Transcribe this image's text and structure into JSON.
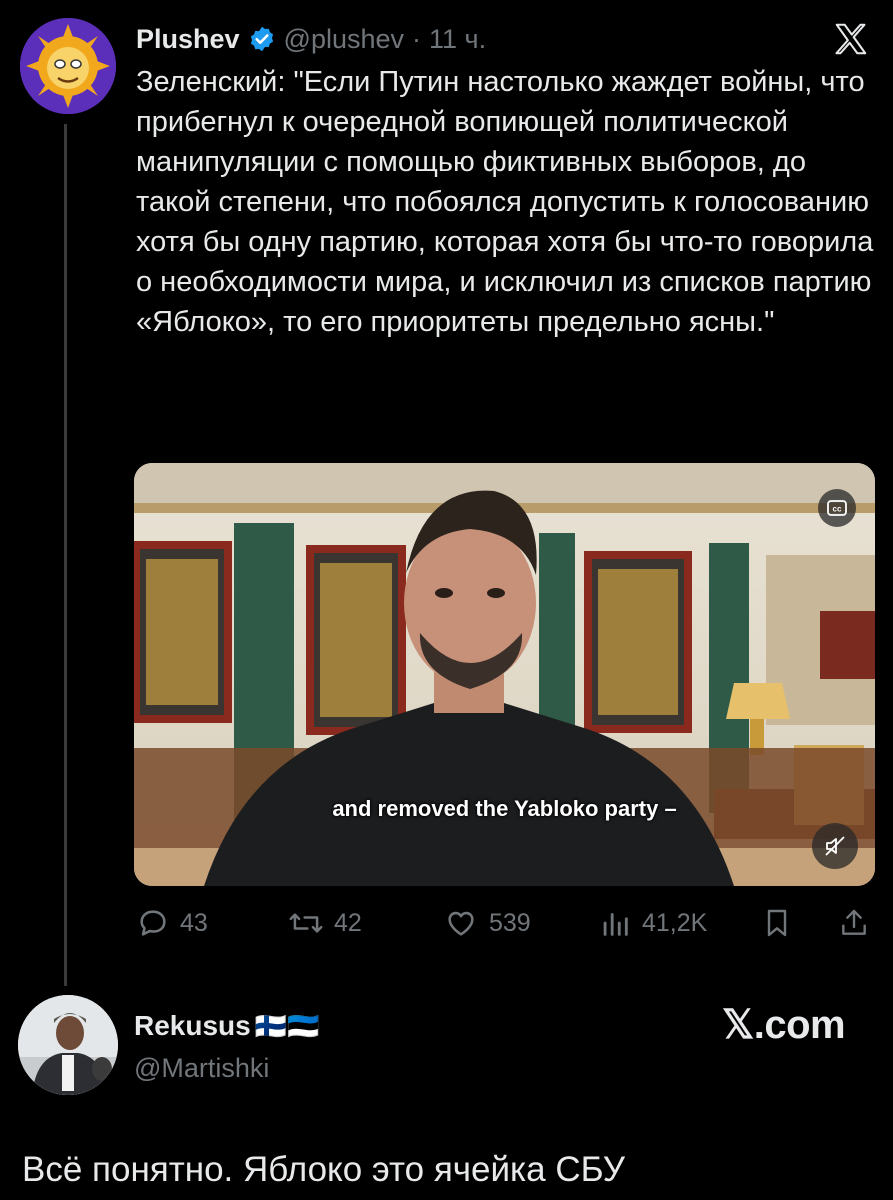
{
  "tweet": {
    "author_name": "Plushev",
    "handle": "@plushev",
    "separator": "·",
    "time": "11 ч.",
    "text": "Зеленский: \"Если Путин настолько жаждет войны, что прибегнул к очередной вопиющей политической манипуляции с помощью фиктивных выборов, до такой степени, что побоялся допустить к голосованию хотя бы одну партию, которая хотя бы что-то говорила о необходимости мира, и исключил из списков партию «Яблоко», то его приоритеты предельно ясны.\"",
    "verified_icon": "verified-badge-icon",
    "platform_icon": "x-logo-icon",
    "accent_color": "#1d9bf0"
  },
  "video": {
    "subtitle": "and removed the Yabloko party –",
    "cc_icon": "closed-captions-icon",
    "mute_icon": "speaker-muted-icon"
  },
  "actions": {
    "replies": "43",
    "reposts": "42",
    "likes": "539",
    "views": "41,2K",
    "icons": [
      "reply-icon",
      "repost-icon",
      "like-icon",
      "views-icon",
      "bookmark-icon",
      "share-icon"
    ]
  },
  "quote_user": {
    "name": "Rekusus",
    "flags": "🇫🇮🇪🇪",
    "handle": "@Martishki",
    "watermark": "𝕏.com",
    "comment": "Всё понятно.  Яблоко это ячейка СБУ"
  }
}
